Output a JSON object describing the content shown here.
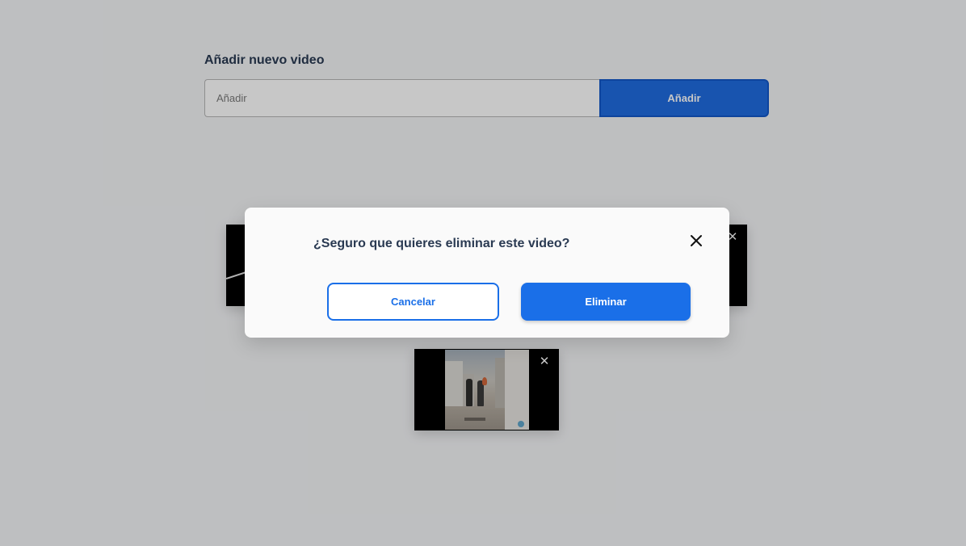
{
  "form": {
    "title": "Añadir nuevo video",
    "input_placeholder": "Añadir",
    "input_value": "",
    "add_button_label": "Añadir"
  },
  "videos": [
    {
      "remove_icon": "close-icon"
    },
    {
      "remove_icon": "close-icon"
    }
  ],
  "icons": {
    "video_remove_glyph": "✕"
  },
  "modal": {
    "title": "¿Seguro que quieres eliminar este video?",
    "cancel_label": "Cancelar",
    "confirm_label": "Eliminar",
    "close_icon": "close-icon"
  },
  "colors": {
    "primary": "#1a6fe8",
    "heading": "#2a3a52",
    "overlay": "rgba(0,0,0,0.22)"
  }
}
